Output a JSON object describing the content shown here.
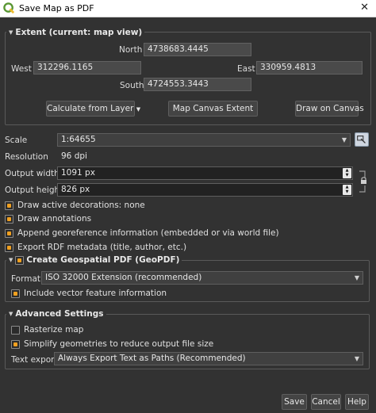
{
  "window": {
    "title": "Save Map as PDF",
    "close_glyph": "✕"
  },
  "extent": {
    "title": "Extent (current: map view)",
    "north_label": "North",
    "north_value": "4738683.4445",
    "west_label": "West",
    "west_value": "312296.1165",
    "east_label": "East",
    "east_value": "330959.4813",
    "south_label": "South",
    "south_value": "4724553.3443",
    "calc_label": "Calculate from Layer",
    "canvas_extent_label": "Map Canvas Extent",
    "draw_canvas_label": "Draw on Canvas"
  },
  "settings": {
    "scale_label": "Scale",
    "scale_value": "1:64655",
    "resolution_label": "Resolution",
    "resolution_value": "96 dpi",
    "width_label": "Output width",
    "width_value": "1091 px",
    "height_label": "Output height",
    "height_value": "826 px"
  },
  "options": [
    {
      "label": "Draw active decorations: none",
      "checked": true
    },
    {
      "label": "Draw annotations",
      "checked": true
    },
    {
      "label": "Append georeference information (embedded or via world file)",
      "checked": true
    },
    {
      "label": "Export RDF metadata (title, author, etc.)",
      "checked": true
    }
  ],
  "geopdf": {
    "title": "Create Geospatial PDF (GeoPDF)",
    "checked": true,
    "format_label": "Format",
    "format_value": "ISO 32000 Extension (recommended)",
    "vector_label": "Include vector feature information",
    "vector_checked": true
  },
  "advanced": {
    "title": "Advanced Settings",
    "rasterize_label": "Rasterize map",
    "rasterize_checked": false,
    "simplify_label": "Simplify geometries to reduce output file size",
    "simplify_checked": true,
    "text_export_label": "Text export",
    "text_export_value": "Always Export Text as Paths (Recommended)"
  },
  "buttons": {
    "save": "Save",
    "cancel": "Cancel",
    "help": "Help"
  },
  "colors": {
    "accent": "#f0a020",
    "background": "#323232",
    "qgis_green": "#589632",
    "qgis_yellow": "#eebc2f"
  },
  "icons": [
    "qgis-logo-icon",
    "close-icon",
    "collapse-triangle-icon",
    "chevron-down-icon",
    "map-canvas-scale-icon",
    "lock-ratio-icon"
  ]
}
